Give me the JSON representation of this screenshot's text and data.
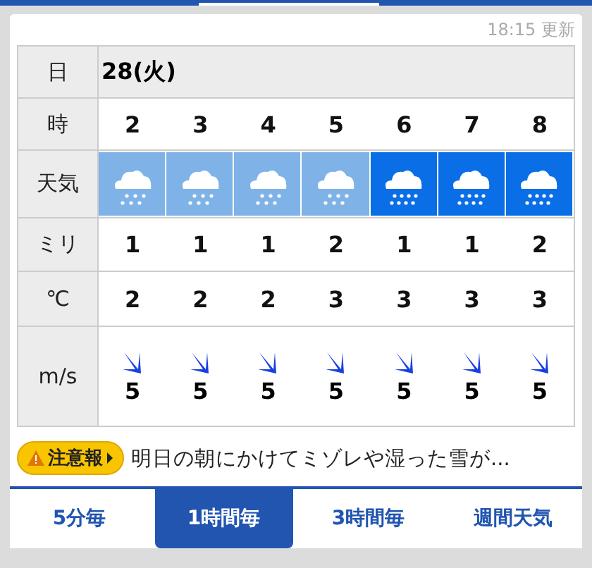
{
  "updated": "18:15 更新",
  "table": {
    "date_label": "日",
    "date": "28(火)",
    "hour_label": "時",
    "weather_label": "天気",
    "precip_label": "ミリ",
    "temp_label": "℃",
    "wind_label": "m/s",
    "hours": [
      {
        "hour": "2",
        "kind": "snow",
        "precip": "1",
        "temp": "2",
        "wind": "5"
      },
      {
        "hour": "3",
        "kind": "snow",
        "precip": "1",
        "temp": "2",
        "wind": "5"
      },
      {
        "hour": "4",
        "kind": "snow",
        "precip": "1",
        "temp": "2",
        "wind": "5"
      },
      {
        "hour": "5",
        "kind": "snow",
        "precip": "2",
        "temp": "3",
        "wind": "5"
      },
      {
        "hour": "6",
        "kind": "sleet",
        "precip": "1",
        "temp": "3",
        "wind": "5"
      },
      {
        "hour": "7",
        "kind": "sleet",
        "precip": "1",
        "temp": "3",
        "wind": "5"
      },
      {
        "hour": "8",
        "kind": "sleet",
        "precip": "2",
        "temp": "3",
        "wind": "5"
      }
    ]
  },
  "notice": {
    "badge": "注意報",
    "text": "明日の朝にかけてミゾレや湿った雪が..."
  },
  "tabs": [
    {
      "label": "5分毎",
      "selected": false
    },
    {
      "label": "1時間毎",
      "selected": true
    },
    {
      "label": "3時間毎",
      "selected": false
    },
    {
      "label": "週間天気",
      "selected": false
    }
  ]
}
